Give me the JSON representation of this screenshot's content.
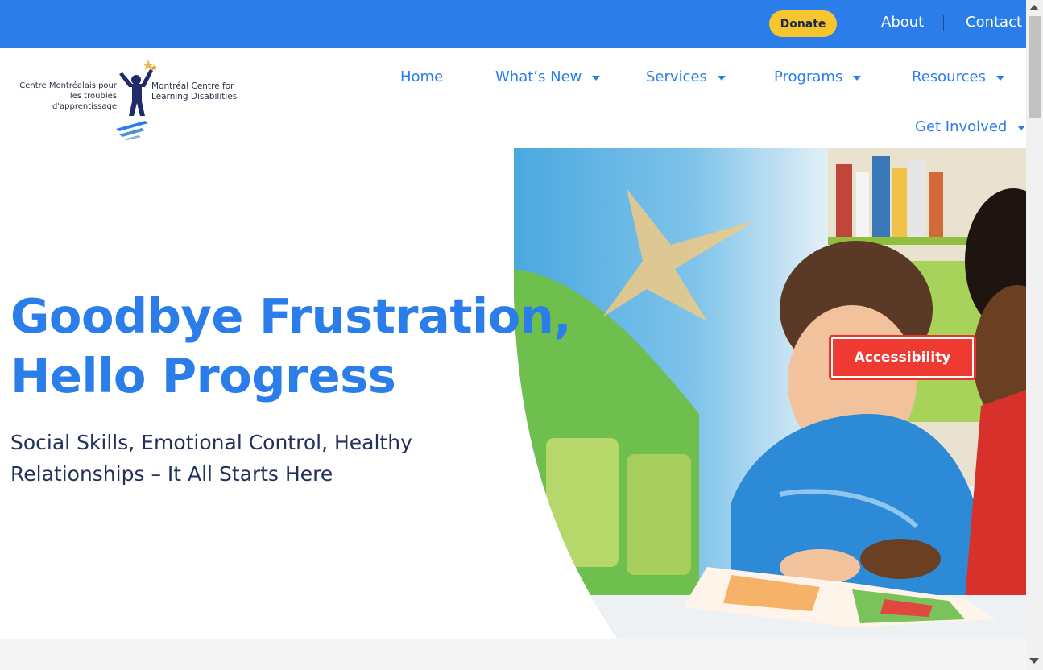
{
  "topbar": {
    "donate_label": "Donate",
    "links": [
      {
        "label": "About"
      },
      {
        "label": "Contact"
      }
    ]
  },
  "logo": {
    "french_name_line1": "Centre Montréalais pour",
    "french_name_line2": "les troubles d'apprentissage",
    "english_name_line1": "Montréal Centre for",
    "english_name_line2": "Learning Disabilities"
  },
  "nav": {
    "items": [
      {
        "label": "Home",
        "has_dropdown": false
      },
      {
        "label": "What’s New",
        "has_dropdown": true
      },
      {
        "label": "Services",
        "has_dropdown": true
      },
      {
        "label": "Programs",
        "has_dropdown": true
      },
      {
        "label": "Resources",
        "has_dropdown": true
      },
      {
        "label": "Get Involved",
        "has_dropdown": true
      }
    ]
  },
  "hero": {
    "title_line1": "Goodbye Frustration,",
    "title_line2": "Hello Progress",
    "subtitle_line1": "Social Skills, Emotional Control, Healthy",
    "subtitle_line2": "Relationships – It All Starts Here"
  },
  "accessibility": {
    "label": "Accessibility"
  },
  "colors": {
    "brand_blue": "#2b7de9",
    "donate_yellow": "#f7c62f",
    "accessibility_red": "#ee3a31",
    "heading_navy": "#22315c"
  }
}
